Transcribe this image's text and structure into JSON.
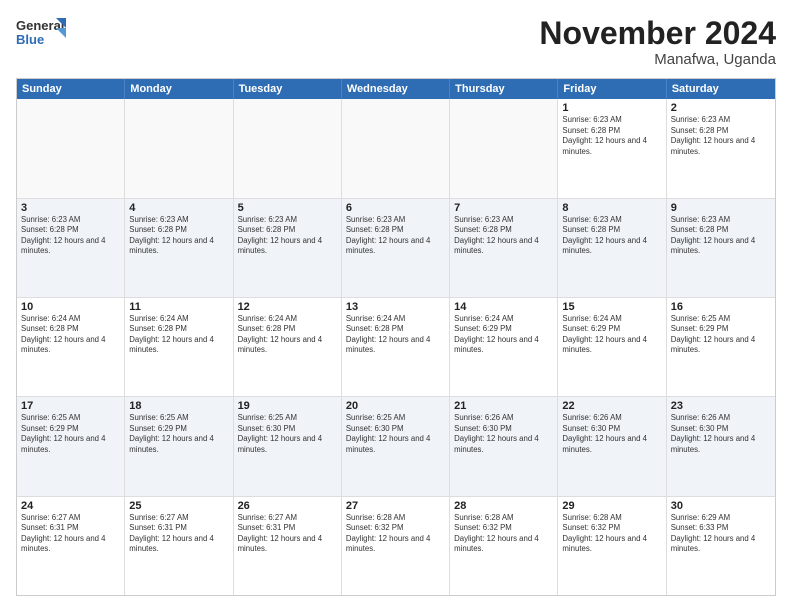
{
  "logo": {
    "line1": "General",
    "line2": "Blue"
  },
  "title": "November 2024",
  "location": "Manafwa, Uganda",
  "header_days": [
    "Sunday",
    "Monday",
    "Tuesday",
    "Wednesday",
    "Thursday",
    "Friday",
    "Saturday"
  ],
  "rows": [
    {
      "alt": false,
      "cells": [
        {
          "day": "",
          "info": ""
        },
        {
          "day": "",
          "info": ""
        },
        {
          "day": "",
          "info": ""
        },
        {
          "day": "",
          "info": ""
        },
        {
          "day": "",
          "info": ""
        },
        {
          "day": "1",
          "info": "Sunrise: 6:23 AM\nSunset: 6:28 PM\nDaylight: 12 hours and 4 minutes."
        },
        {
          "day": "2",
          "info": "Sunrise: 6:23 AM\nSunset: 6:28 PM\nDaylight: 12 hours and 4 minutes."
        }
      ]
    },
    {
      "alt": true,
      "cells": [
        {
          "day": "3",
          "info": "Sunrise: 6:23 AM\nSunset: 6:28 PM\nDaylight: 12 hours and 4 minutes."
        },
        {
          "day": "4",
          "info": "Sunrise: 6:23 AM\nSunset: 6:28 PM\nDaylight: 12 hours and 4 minutes."
        },
        {
          "day": "5",
          "info": "Sunrise: 6:23 AM\nSunset: 6:28 PM\nDaylight: 12 hours and 4 minutes."
        },
        {
          "day": "6",
          "info": "Sunrise: 6:23 AM\nSunset: 6:28 PM\nDaylight: 12 hours and 4 minutes."
        },
        {
          "day": "7",
          "info": "Sunrise: 6:23 AM\nSunset: 6:28 PM\nDaylight: 12 hours and 4 minutes."
        },
        {
          "day": "8",
          "info": "Sunrise: 6:23 AM\nSunset: 6:28 PM\nDaylight: 12 hours and 4 minutes."
        },
        {
          "day": "9",
          "info": "Sunrise: 6:23 AM\nSunset: 6:28 PM\nDaylight: 12 hours and 4 minutes."
        }
      ]
    },
    {
      "alt": false,
      "cells": [
        {
          "day": "10",
          "info": "Sunrise: 6:24 AM\nSunset: 6:28 PM\nDaylight: 12 hours and 4 minutes."
        },
        {
          "day": "11",
          "info": "Sunrise: 6:24 AM\nSunset: 6:28 PM\nDaylight: 12 hours and 4 minutes."
        },
        {
          "day": "12",
          "info": "Sunrise: 6:24 AM\nSunset: 6:28 PM\nDaylight: 12 hours and 4 minutes."
        },
        {
          "day": "13",
          "info": "Sunrise: 6:24 AM\nSunset: 6:28 PM\nDaylight: 12 hours and 4 minutes."
        },
        {
          "day": "14",
          "info": "Sunrise: 6:24 AM\nSunset: 6:29 PM\nDaylight: 12 hours and 4 minutes."
        },
        {
          "day": "15",
          "info": "Sunrise: 6:24 AM\nSunset: 6:29 PM\nDaylight: 12 hours and 4 minutes."
        },
        {
          "day": "16",
          "info": "Sunrise: 6:25 AM\nSunset: 6:29 PM\nDaylight: 12 hours and 4 minutes."
        }
      ]
    },
    {
      "alt": true,
      "cells": [
        {
          "day": "17",
          "info": "Sunrise: 6:25 AM\nSunset: 6:29 PM\nDaylight: 12 hours and 4 minutes."
        },
        {
          "day": "18",
          "info": "Sunrise: 6:25 AM\nSunset: 6:29 PM\nDaylight: 12 hours and 4 minutes."
        },
        {
          "day": "19",
          "info": "Sunrise: 6:25 AM\nSunset: 6:30 PM\nDaylight: 12 hours and 4 minutes."
        },
        {
          "day": "20",
          "info": "Sunrise: 6:25 AM\nSunset: 6:30 PM\nDaylight: 12 hours and 4 minutes."
        },
        {
          "day": "21",
          "info": "Sunrise: 6:26 AM\nSunset: 6:30 PM\nDaylight: 12 hours and 4 minutes."
        },
        {
          "day": "22",
          "info": "Sunrise: 6:26 AM\nSunset: 6:30 PM\nDaylight: 12 hours and 4 minutes."
        },
        {
          "day": "23",
          "info": "Sunrise: 6:26 AM\nSunset: 6:30 PM\nDaylight: 12 hours and 4 minutes."
        }
      ]
    },
    {
      "alt": false,
      "cells": [
        {
          "day": "24",
          "info": "Sunrise: 6:27 AM\nSunset: 6:31 PM\nDaylight: 12 hours and 4 minutes."
        },
        {
          "day": "25",
          "info": "Sunrise: 6:27 AM\nSunset: 6:31 PM\nDaylight: 12 hours and 4 minutes."
        },
        {
          "day": "26",
          "info": "Sunrise: 6:27 AM\nSunset: 6:31 PM\nDaylight: 12 hours and 4 minutes."
        },
        {
          "day": "27",
          "info": "Sunrise: 6:28 AM\nSunset: 6:32 PM\nDaylight: 12 hours and 4 minutes."
        },
        {
          "day": "28",
          "info": "Sunrise: 6:28 AM\nSunset: 6:32 PM\nDaylight: 12 hours and 4 minutes."
        },
        {
          "day": "29",
          "info": "Sunrise: 6:28 AM\nSunset: 6:32 PM\nDaylight: 12 hours and 4 minutes."
        },
        {
          "day": "30",
          "info": "Sunrise: 6:29 AM\nSunset: 6:33 PM\nDaylight: 12 hours and 4 minutes."
        }
      ]
    }
  ]
}
